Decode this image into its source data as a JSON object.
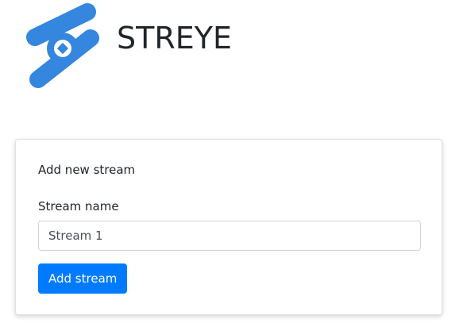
{
  "app": {
    "title": "STREYE",
    "logo_icon": "streye-logo-icon",
    "brand_color": "#3486DE"
  },
  "form": {
    "title": "Add new stream",
    "stream_name_label": "Stream name",
    "stream_name_value": "Stream 1",
    "submit_label": "Add stream",
    "submit_color": "#007BFF"
  }
}
